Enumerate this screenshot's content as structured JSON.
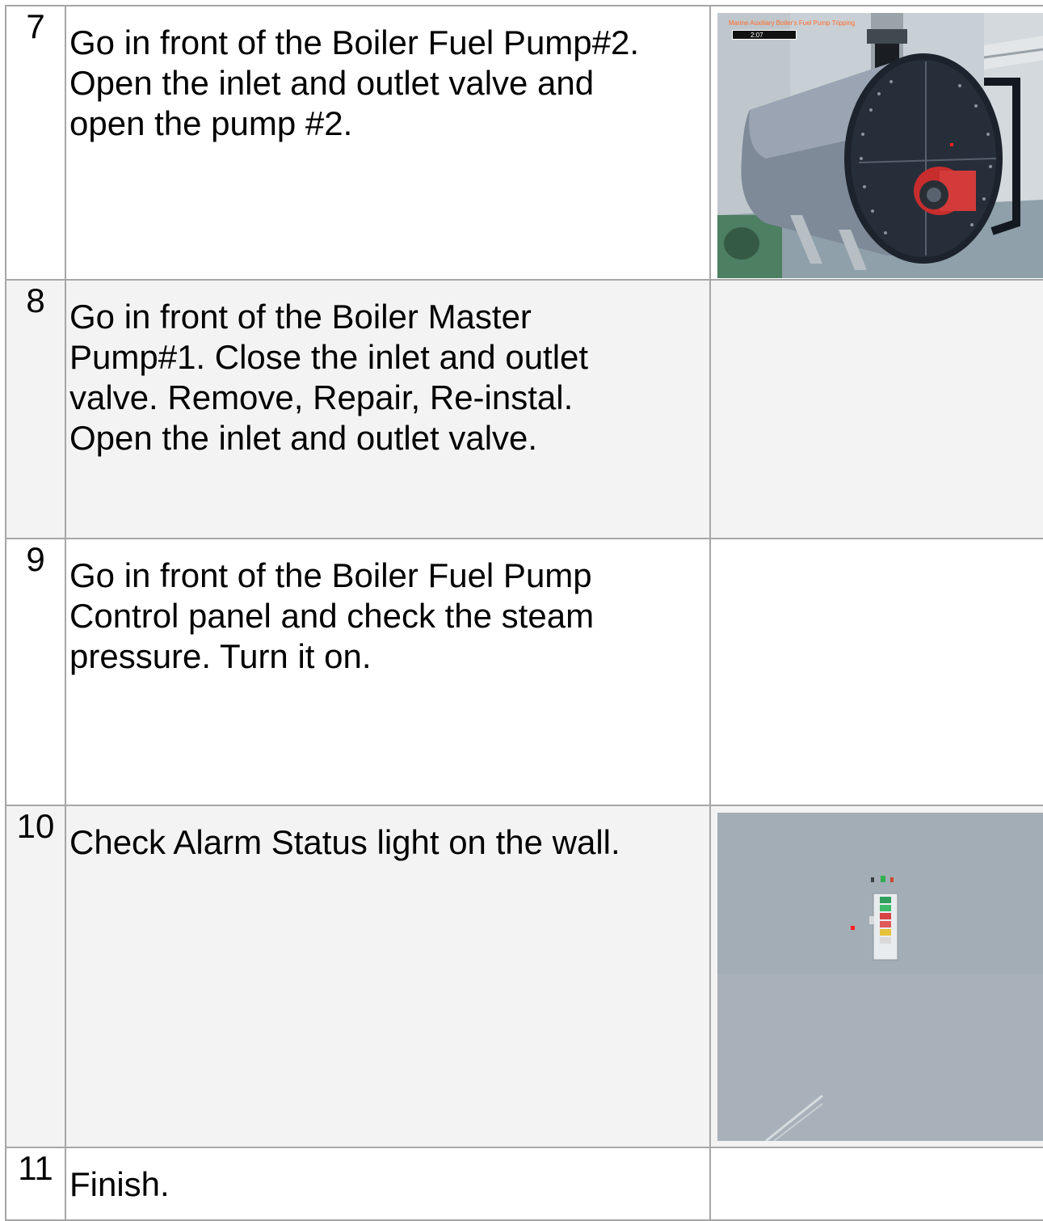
{
  "steps": [
    {
      "number": "7",
      "lines": [
        "Go in front of the Boiler Fuel Pump#2.",
        "Open the inlet and outlet valve and",
        "open the pump #2."
      ],
      "screenshot": {
        "hud_title": "Marine Auxiliary Boiler's Fuel Pump Tripping",
        "hud_timer": "2:07"
      }
    },
    {
      "number": "8",
      "lines": [
        "Go in front of the Boiler Master",
        "Pump#1. Close the inlet and outlet",
        "valve. Remove, Repair, Re-instal.",
        "Open the inlet and outlet valve."
      ]
    },
    {
      "number": "9",
      "lines": [
        "Go in front of the Boiler Fuel Pump",
        "Control panel and check the steam",
        "pressure. Turn it on."
      ]
    },
    {
      "number": "10",
      "lines": [
        "Check Alarm Status light on the wall."
      ]
    },
    {
      "number": "11",
      "lines": [
        "Finish."
      ]
    }
  ]
}
